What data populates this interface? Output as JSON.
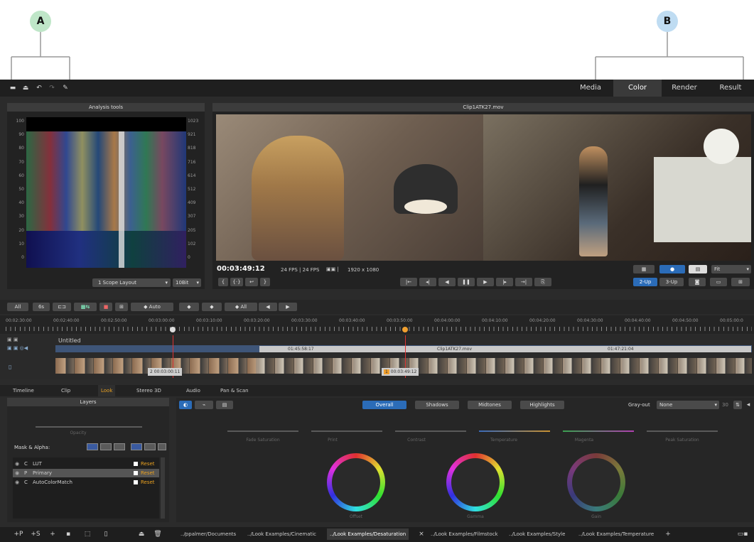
{
  "callouts": {
    "a": "A",
    "b": "B"
  },
  "colors": {
    "callout_a": "#bfe6c8",
    "callout_b": "#bfdcf2",
    "accent": "#2b6cb8",
    "playhead": "#f0a030",
    "reset": "#e8a020"
  },
  "toolbar": {
    "icons": [
      "folder-open-icon",
      "export-icon",
      "undo-icon",
      "redo-icon",
      "wrench-icon"
    ]
  },
  "tabs": [
    "Media",
    "Color",
    "Render",
    "Result"
  ],
  "active_tab": "Color",
  "analysis": {
    "title": "Analysis tools",
    "left_ticks": [
      "100",
      "90",
      "80",
      "70",
      "60",
      "50",
      "40",
      "30",
      "20",
      "10",
      "0"
    ],
    "right_ticks": [
      "1023",
      "921",
      "818",
      "716",
      "614",
      "512",
      "409",
      "307",
      "205",
      "102",
      "0"
    ],
    "layout_select": "1 Scope Layout",
    "bit_select": "10Bit"
  },
  "viewer": {
    "clip_title": "Clip1ATK27.mov",
    "timecode": "00:03:49:12",
    "info": "24 FPS | 24 FPS",
    "resolution": "1920 x 1080",
    "fit_select": "Fit",
    "split_buttons": [
      "2-Up",
      "3-Up"
    ]
  },
  "toolbar2": {
    "buttons": [
      "All",
      "6s",
      "Auto",
      "All"
    ]
  },
  "ruler": [
    "00:02:30:00",
    "00:02:40:00",
    "00:02:50:00",
    "00:03:00:00",
    "00:03:10:00",
    "00:03:20:00",
    "00:03:30:00",
    "00:03:40:00",
    "00:03:50:00",
    "00:04:00:00",
    "00:04:10:00",
    "00:04:20:00",
    "00:04:30:00",
    "00:04:40:00",
    "00:04:50:00",
    "00:05:00:0"
  ],
  "timeline": {
    "track_name": "Untitled",
    "clip_in": "01:45:58:17",
    "clip_name": "Clip1ATK27.mov",
    "clip_out": "01:47:21:04",
    "marker1_index": "2",
    "marker1_tc": "00:03:00:11",
    "marker2_index": "1",
    "marker2_tc": "00:03:49:12"
  },
  "bottom_tabs": [
    "Timeline",
    "Clip",
    "Look",
    "Stereo 3D",
    "Audio",
    "Pan & Scan"
  ],
  "layers": {
    "title": "Layers",
    "opacity_label": "Opacity",
    "mask_label": "Mask & Alpha:",
    "items": [
      {
        "type": "C",
        "name": "LUT",
        "reset": "Reset"
      },
      {
        "type": "P",
        "name": "Primary",
        "reset": "Reset"
      },
      {
        "type": "C",
        "name": "AutoColorMatch",
        "reset": "Reset"
      }
    ]
  },
  "color_panel": {
    "tone_tabs": [
      "Overall",
      "Shadows",
      "Midtones",
      "Highlights"
    ],
    "grayout_label": "Gray-out",
    "grayout_value": "None",
    "grayout_num": "30",
    "sliders": [
      "Fade Saturation",
      "Print",
      "Contrast",
      "Temperature",
      "Magenta",
      "Peak Saturation"
    ],
    "wheels": [
      "Offset",
      "Gamma",
      "Gain"
    ]
  },
  "bottom_bar": {
    "icons": [
      "+P",
      "+S"
    ],
    "path_tabs": [
      "../ppalmer/Documents",
      "../Look Examples/Cinematic",
      "../Look Examples/Desaturation",
      "../Look Examples/Filmstock",
      "../Look Examples/Style",
      "../Look Examples/Temperature"
    ],
    "active_path_tab": "../Look Examples/Desaturation"
  }
}
